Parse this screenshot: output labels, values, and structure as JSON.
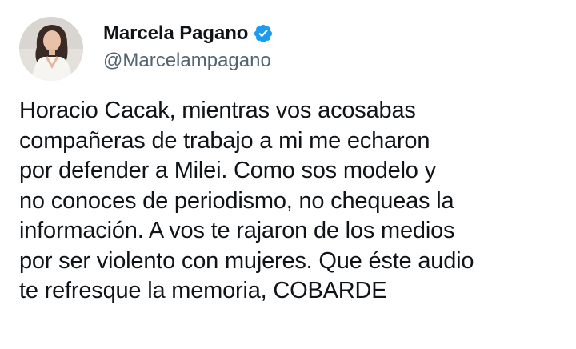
{
  "author": {
    "display_name": "Marcela Pagano",
    "handle": "@Marcelampagano",
    "verified_icon": "verified-badge-icon",
    "badge_color": "#1d9bf0"
  },
  "tweet": {
    "lines": [
      "Horacio Cacak, mientras vos acosabas",
      "compañeras de trabajo a mi me echaron",
      "por defender a Milei. Como sos modelo y",
      "no conoces de periodismo, no chequeas la",
      "información. A vos te rajaron de los medios",
      "por ser violento con mujeres. Que éste audio",
      "te refresque la memoria, COBARDE"
    ]
  }
}
